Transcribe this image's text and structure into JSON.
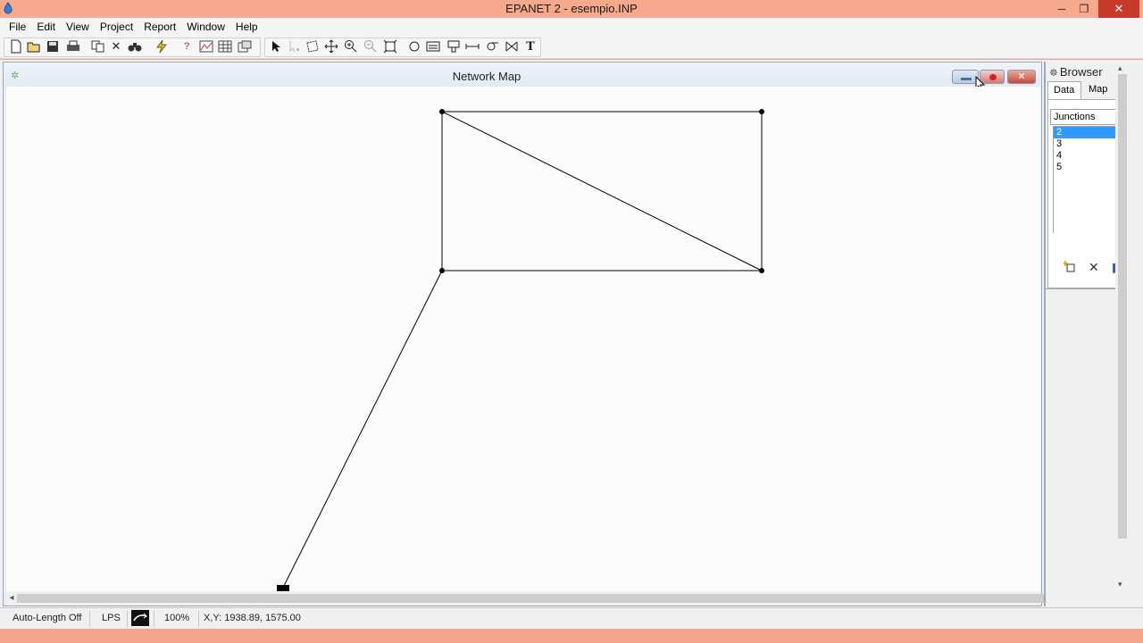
{
  "app": {
    "title": "EPANET 2 - esempio.INP"
  },
  "window_controls": {
    "minimize": "─",
    "maximize": "❐",
    "close": "✕"
  },
  "menu": [
    "File",
    "Edit",
    "View",
    "Project",
    "Report",
    "Window",
    "Help"
  ],
  "toolbar": {
    "icons": [
      "new-icon",
      "open-icon",
      "save-icon",
      "print-icon",
      "copy-icon",
      "delete-icon",
      "find-icon",
      "run-icon",
      "query-icon",
      "graph-icon",
      "table-icon",
      "options-icon",
      "select-arrow-icon",
      "select-vertex-icon",
      "select-region-icon",
      "pan-icon",
      "zoom-in-icon",
      "zoom-out-icon",
      "full-extent-icon",
      "junction-icon",
      "reservoir-icon",
      "tank-icon",
      "pipe-icon",
      "pump-icon",
      "valve-icon",
      "label-icon"
    ]
  },
  "network_map": {
    "title": "Network Map",
    "close_label": "✕"
  },
  "browser": {
    "title": "Browser",
    "tabs": [
      "Data",
      "Map"
    ],
    "category": "Junctions",
    "items": [
      "2",
      "3",
      "4",
      "5"
    ],
    "selected_item": "2"
  },
  "statusbar": {
    "auto_length": "Auto-Length Off",
    "units": "LPS",
    "zoom": "100%",
    "xy": "X,Y: 1938.89, 1575.00"
  }
}
